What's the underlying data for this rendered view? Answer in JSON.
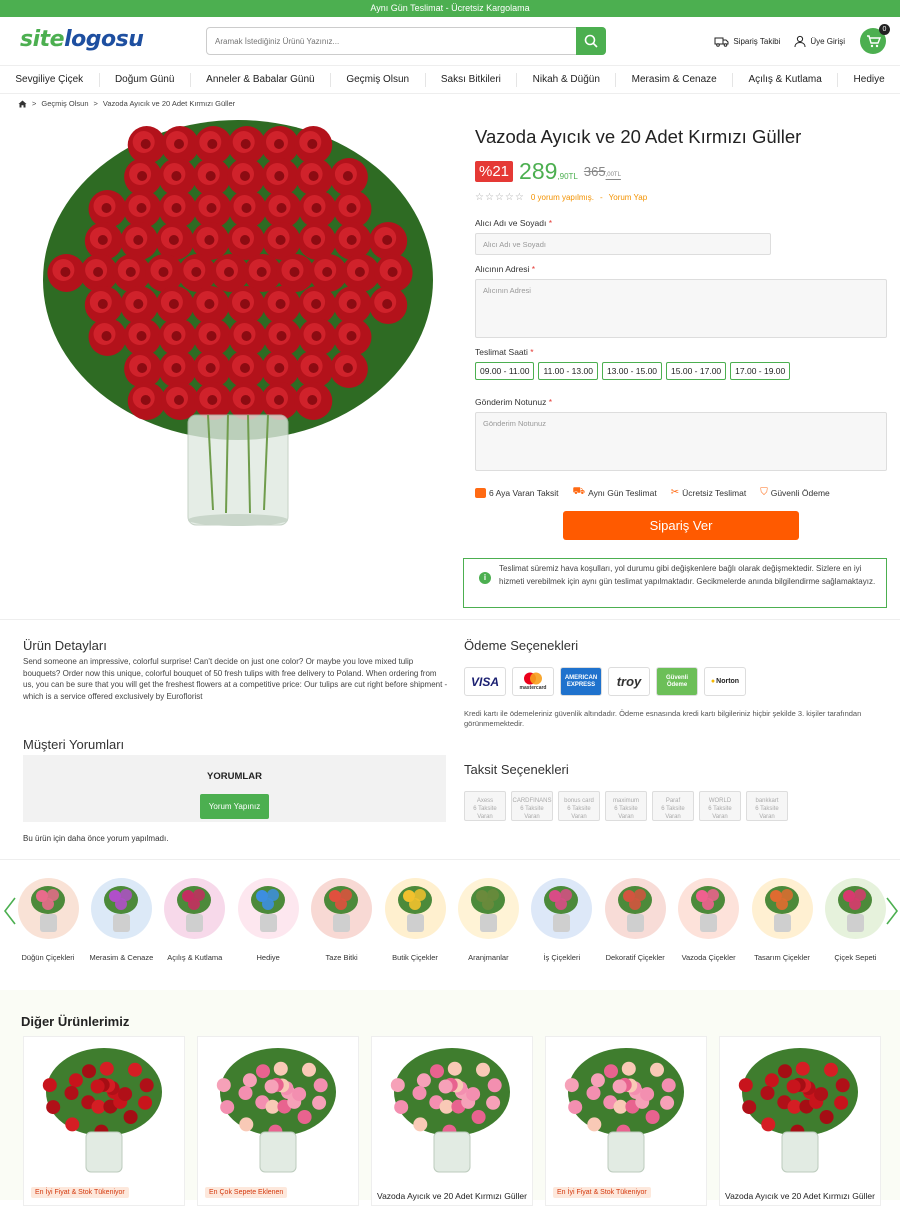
{
  "topbar": {
    "text": "Aynı Gün Teslimat - Ücretsiz Kargolama"
  },
  "header": {
    "logo_a": "site",
    "logo_b": "logosu",
    "search_placeholder": "Aramak İstediğiniz Ürünü Yazınız...",
    "track_label": "Sipariş Takibi",
    "login_label": "Üye Girişi",
    "cart_count": "0"
  },
  "nav": [
    "Sevgiliye Çiçek",
    "Doğum Günü",
    "Anneler & Babalar Günü",
    "Geçmiş Olsun",
    "Saksı Bitkileri",
    "Nikah & Düğün",
    "Merasim & Cenaze",
    "Açılış & Kutlama",
    "Hediye"
  ],
  "breadcrumb": {
    "sep": ">",
    "items": [
      "Geçmiş Olsun",
      "Vazoda Ayıcık ve 20 Adet Kırmızı Güller"
    ]
  },
  "product": {
    "title": "Vazoda Ayıcık ve 20 Adet Kırmızı Güller",
    "discount": "%21",
    "price": "289",
    "price_cents": ",90TL",
    "old_price": "365",
    "old_cents": ",00TL",
    "rating_text": "0 yorum yapılmış.",
    "rating_sep": "-",
    "review_link": "Yorum Yap",
    "stars": "☆☆☆☆☆"
  },
  "form": {
    "recipient_label": "Alıcı Adı ve Soyadı",
    "recipient_placeholder": "Alıcı Adı ve Soyadı",
    "address_label": "Alıcının Adresi",
    "address_placeholder": "Alıcının Adresi",
    "time_label": "Teslimat Saati",
    "slots": [
      "09.00 - 11.00",
      "11.00 - 13.00",
      "13.00 - 15.00",
      "15.00 - 17.00",
      "17.00 - 19.00"
    ],
    "note_label": "Gönderim Notunuz",
    "note_placeholder": "Gönderim Notunuz",
    "required": "*"
  },
  "features": [
    "6 Aya Varan Taksit",
    "Aynı Gün Teslimat",
    "Ücretsiz Teslimat",
    "Güvenli Ödeme"
  ],
  "order_button": "Sipariş Ver",
  "notice": "Teslimat süremiz hava koşulları, yol durumu gibi değişkenlere bağlı olarak değişmektedir. Sizlere en iyi hizmeti verebilmek için aynı gün teslimat yapılmaktadır. Gecikmelerde anında bilgilendirme sağlamaktayız.",
  "details": {
    "title": "Ürün Detayları",
    "text": "Send someone an impressive, colorful surprise! Can't decide on just one color? Or maybe you love mixed tulip bouquets? Order now this unique, colorful bouquet of 50 fresh tulips with free delivery to Poland. When ordering from us, you can be sure that you will get the freshest flowers at a competitive price: Our tulips are cut right before shipment - which is a service offered exclusively by Euroflorist"
  },
  "reviews": {
    "title": "Müşteri Yorumları",
    "box_title": "YORUMLAR",
    "button": "Yorum Yapınız",
    "empty": "Bu ürün için daha önce yorum yapılmadı."
  },
  "payment": {
    "title": "Ödeme Seçenekleri",
    "cards": [
      "VISA",
      "mastercard",
      "AMERICAN EXPRESS",
      "troy",
      "Güvenli Ödeme",
      "Norton"
    ],
    "text": "Kredi kartı ile ödemeleriniz güvenlik altındadır. Ödeme esnasında kredi kartı bilgileriniz hiçbir şekilde 3. kişiler tarafından görünmemektedir."
  },
  "installments": {
    "title": "Taksit Seçenekleri",
    "banks": [
      "Axess",
      "CARDFINANS",
      "bonus card",
      "maximum",
      "Paraf",
      "WORLD",
      "bankkart"
    ],
    "bank_note": "6 Taksite Varan"
  },
  "categories": [
    "Düğün Çiçekleri",
    "Merasim & Cenaze",
    "Açılış & Kutlama",
    "Hediye",
    "Taze Bitki",
    "Butik Çiçekler",
    "Aranjmanlar",
    "İş Çiçekleri",
    "Dekoratif Çiçekler",
    "Vazoda Çiçekler",
    "Tasarım Çiçekler",
    "Çiçek Sepeti"
  ],
  "other": {
    "title": "Diğer Ürünlerimiz",
    "products": [
      {
        "tag": "En İyi Fiyat & Stok Tükeniyor",
        "name": ""
      },
      {
        "tag": "En Çok Sepete Eklenen",
        "name": ""
      },
      {
        "tag": "",
        "name": "Vazoda Ayıcık ve 20 Adet Kırmızı Güller"
      },
      {
        "tag": "En İyi Fiyat & Stok Tükeniyor",
        "name": ""
      },
      {
        "tag": "",
        "name": "Vazoda Ayıcık ve 20 Adet Kırmızı Güller"
      }
    ]
  },
  "colors": {
    "brand_green": "#4caf50",
    "brand_blue": "#1e4fa0",
    "order_orange": "#ff5a00",
    "discount_red": "#e53935"
  }
}
